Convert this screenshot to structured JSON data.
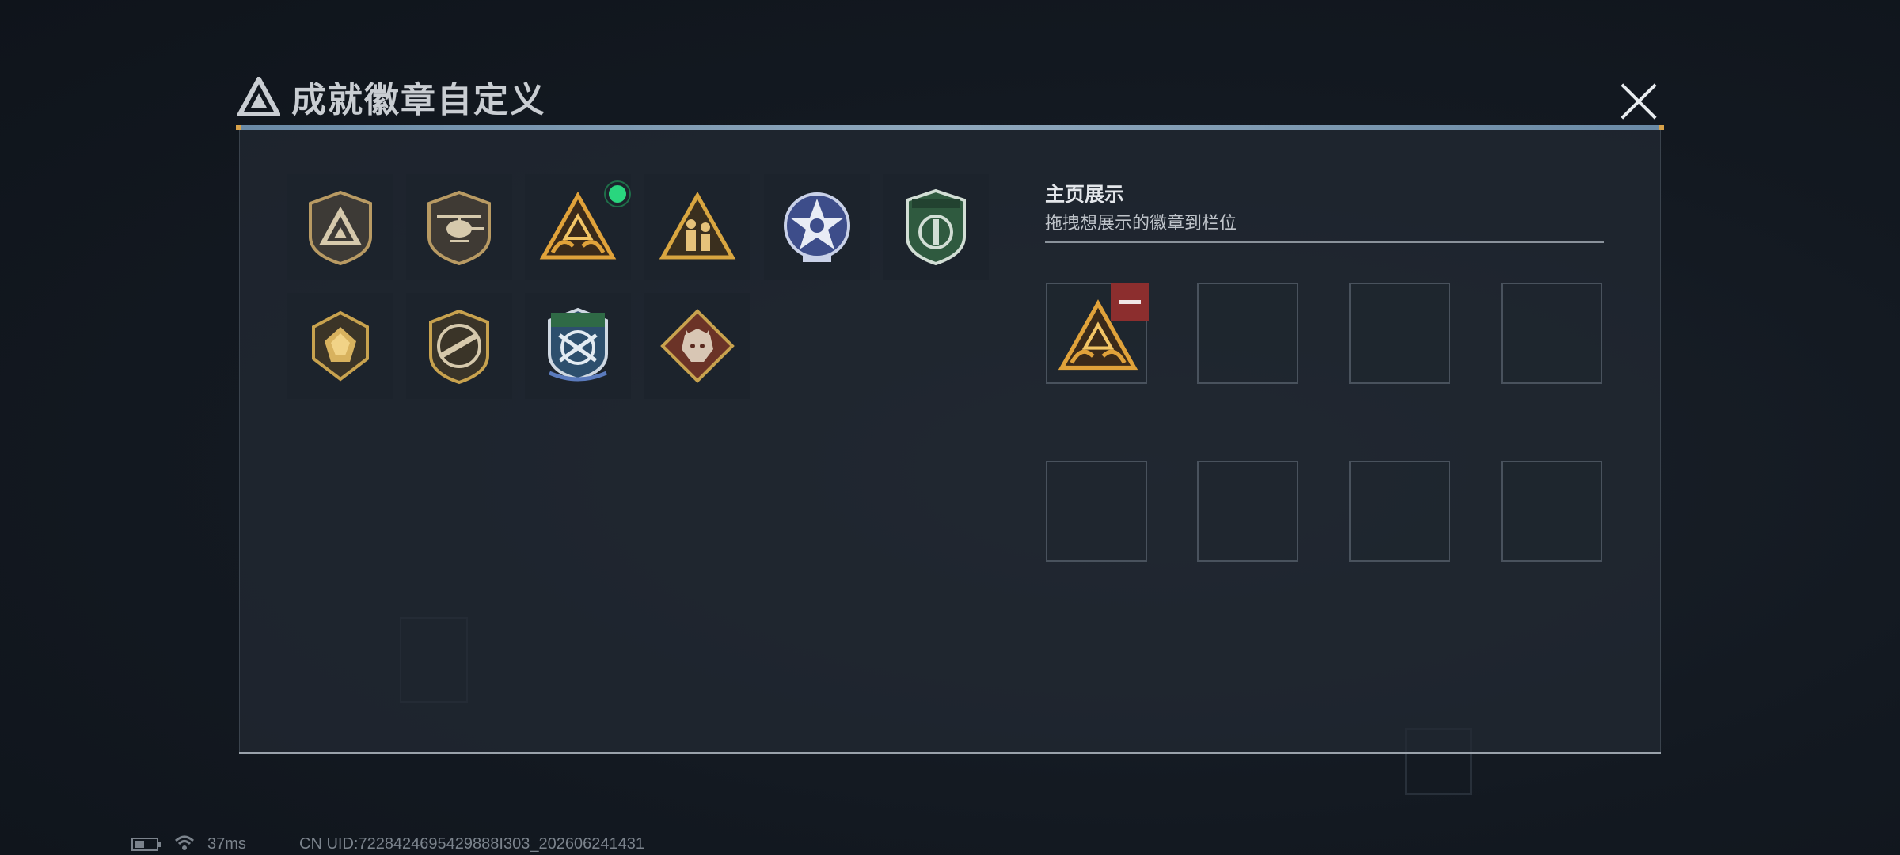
{
  "modal": {
    "title": "成就徽章自定义",
    "title_icon": "triangle-logo-icon",
    "close_icon": "close-icon"
  },
  "badges": [
    {
      "name": "triangle-shield-badge",
      "selected": false
    },
    {
      "name": "helicopter-badge",
      "selected": false
    },
    {
      "name": "hands-triangle-badge",
      "selected": true
    },
    {
      "name": "soldiers-triangle-badge",
      "selected": false
    },
    {
      "name": "star-emblem-badge",
      "selected": false
    },
    {
      "name": "green-shield-badge",
      "selected": false
    },
    {
      "name": "gold-gem-badge",
      "selected": false
    },
    {
      "name": "rifle-crest-badge",
      "selected": false
    },
    {
      "name": "blue-crossed-rifles-badge",
      "selected": false
    },
    {
      "name": "wolf-diamond-badge",
      "selected": false
    }
  ],
  "showcase": {
    "title": "主页展示",
    "subtitle": "拖拽想展示的徽章到栏位",
    "slots": [
      "hands-triangle-badge",
      "",
      "",
      "",
      "",
      "",
      "",
      ""
    ],
    "remove_icon": "minus-icon"
  },
  "status_bar": {
    "ping": "37ms",
    "uid": "CN UID:7228424695429888I303_202606241431"
  },
  "colors": {
    "accent_green": "#29d67e",
    "remove_red": "#8c2e2e",
    "gold": "#c8a24e"
  }
}
